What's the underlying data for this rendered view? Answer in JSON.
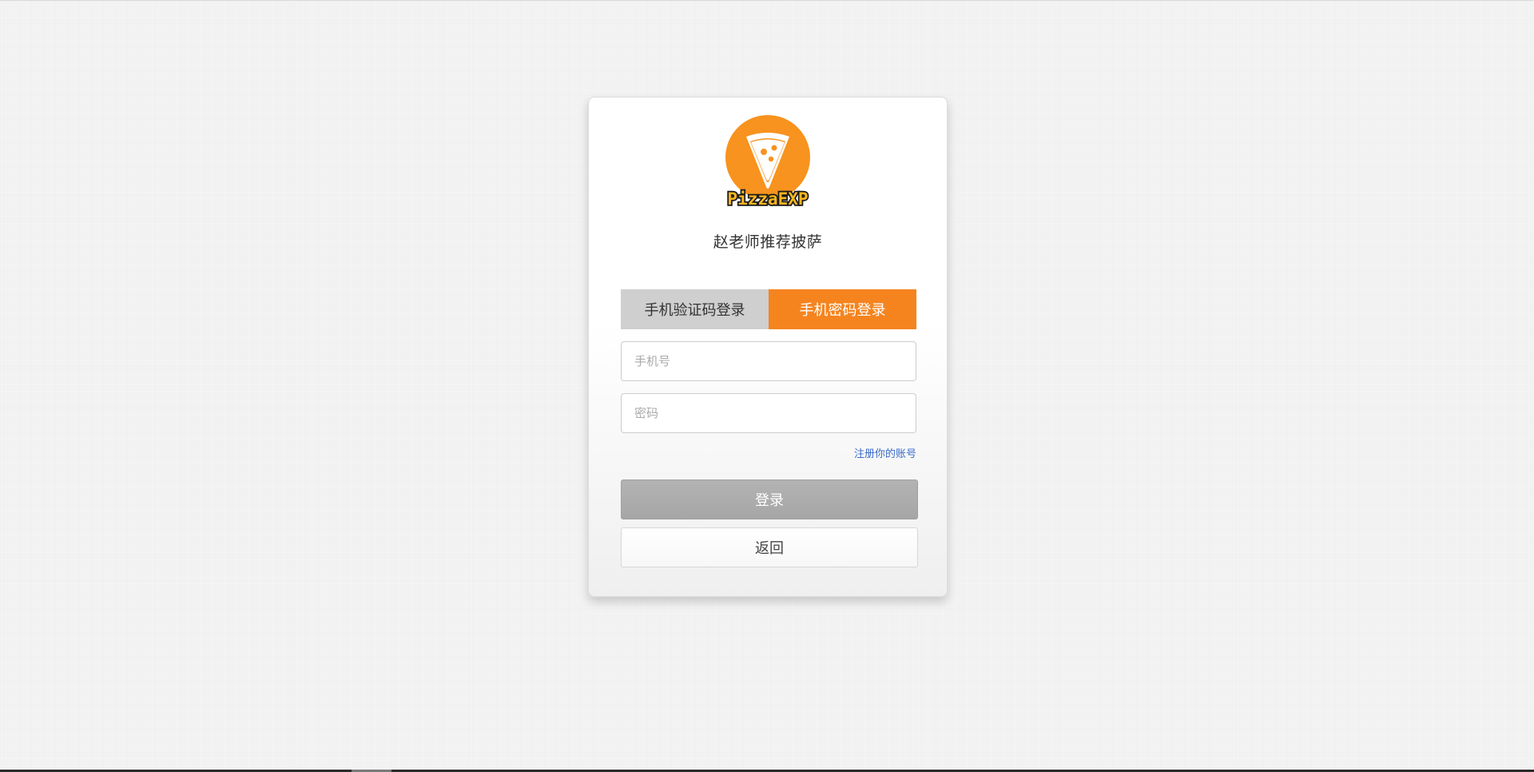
{
  "brand": {
    "logo_text": "PizzaEXP",
    "title": "赵老师推荐披萨",
    "accent_color": "#f5841f",
    "logo_color": "#f7931e"
  },
  "tabs": [
    {
      "label": "手机验证码登录",
      "active": false
    },
    {
      "label": "手机密码登录",
      "active": true
    }
  ],
  "form": {
    "phone_placeholder": "手机号",
    "password_placeholder": "密码",
    "register_link": "注册你的账号",
    "login_label": "登录",
    "back_label": "返回"
  }
}
